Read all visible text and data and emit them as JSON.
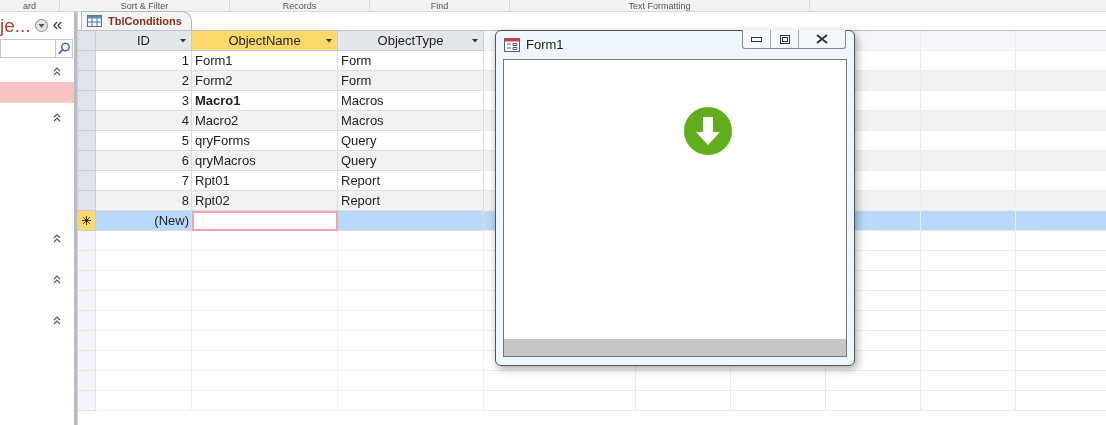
{
  "ribbon_groups": [
    "ard",
    "Sort & Filter",
    "Records",
    "Find",
    "Text Formatting"
  ],
  "nav_pane": {
    "title": "je...",
    "items": [
      {
        "kind": "chevron"
      },
      {
        "kind": "item",
        "selected": true
      },
      {
        "kind": "chevron"
      },
      {
        "kind": "gap"
      },
      {
        "kind": "chevron"
      },
      {
        "kind": "chevron"
      },
      {
        "kind": "chevron"
      }
    ]
  },
  "tabs": [
    {
      "label": "TblConditions",
      "selected": true
    }
  ],
  "table": {
    "columns": [
      {
        "label": "ID",
        "selected": false
      },
      {
        "label": "ObjectName",
        "selected": true
      },
      {
        "label": "ObjectType",
        "selected": false
      }
    ],
    "rows": [
      {
        "id": "1",
        "object_name": "Form1",
        "object_type": "Form",
        "bold": false
      },
      {
        "id": "2",
        "object_name": "Form2",
        "object_type": "Form",
        "bold": false
      },
      {
        "id": "3",
        "object_name": "Macro1",
        "object_type": "Macros",
        "bold": true
      },
      {
        "id": "4",
        "object_name": "Macro2",
        "object_type": "Macros",
        "bold": false
      },
      {
        "id": "5",
        "object_name": "qryForms",
        "object_type": "Query",
        "bold": false
      },
      {
        "id": "6",
        "object_name": "qryMacros",
        "object_type": "Query",
        "bold": false
      },
      {
        "id": "7",
        "object_name": "Rpt01",
        "object_type": "Report",
        "bold": false
      },
      {
        "id": "8",
        "object_name": "Rpt02",
        "object_type": "Report",
        "bold": false
      }
    ],
    "new_row": {
      "id": "(New)",
      "selected": true
    }
  },
  "form_window": {
    "title": "Form1"
  }
}
